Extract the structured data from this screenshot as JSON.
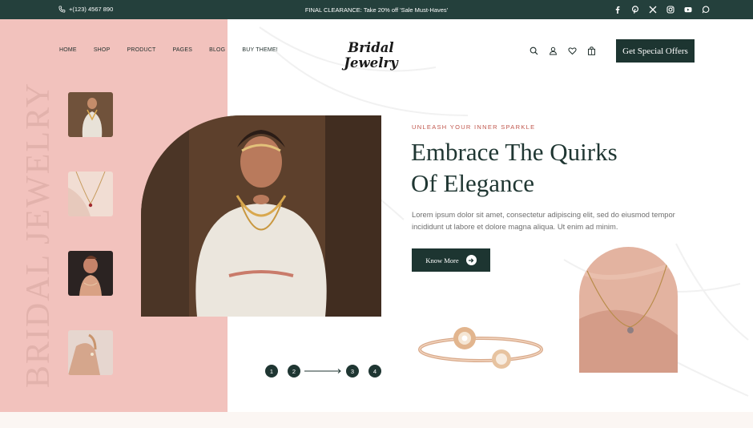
{
  "topbar": {
    "phone": "+(123) 4567 890",
    "promo": "FINAL CLEARANCE: Take 20% off 'Sale Must-Haves'",
    "social_icons": [
      "facebook-icon",
      "pinterest-icon",
      "x-icon",
      "instagram-icon",
      "youtube-icon",
      "whatsapp-icon"
    ]
  },
  "nav": {
    "items": [
      "HOME",
      "SHOP",
      "PRODUCT",
      "PAGES",
      "BLOG",
      "BUY THEME!"
    ]
  },
  "logo": "Bridal Jewelry",
  "header_icons": [
    "search-icon",
    "user-icon",
    "heart-icon",
    "bag-icon"
  ],
  "offer_button": "Get Special Offers",
  "sidebar": {
    "vertical_text": "BRIDAL JEWELRY"
  },
  "hero": {
    "eyebrow": "UNLEASH YOUR INNER SPARKLE",
    "headline_line1": "Embrace The Quirks",
    "headline_line2": "Of Elegance",
    "description": "Lorem ipsum dolor sit amet, consectetur adipiscing elit, sed do eiusmod tempor incididunt ut labore et dolore magna aliqua. Ut enim ad minim.",
    "button_label": "Know More"
  },
  "pagination": {
    "pages": [
      "1",
      "2",
      "3",
      "4"
    ]
  },
  "colors": {
    "dark_teal": "#1d3531",
    "pink_panel": "#f2c2bd",
    "accent_red": "#c0574d"
  }
}
